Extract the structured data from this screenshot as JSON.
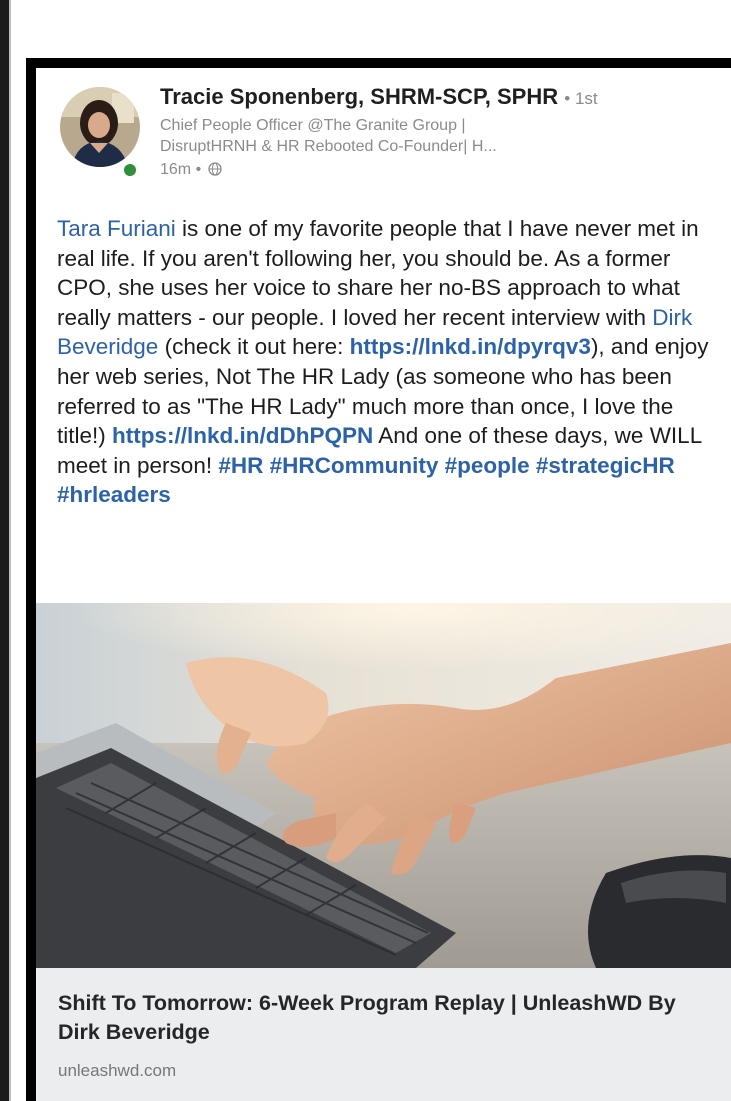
{
  "post": {
    "author": {
      "name": "Tracie Sponenberg, SHRM-SCP, SPHR",
      "degree": "• 1st",
      "headline_line1": "Chief People Officer @The Granite Group |",
      "headline_line2": "DisruptHRNH & HR Rebooted Co-Founder| H...",
      "posted_time": "16m •",
      "avatar_icon": "profile-photo",
      "presence_icon": "online-status-icon",
      "visibility_icon": "globe-icon"
    },
    "body": {
      "mention_tara": "Tara Furiani",
      "text_1": " is one of my favorite people that I have never met in real life.  If you aren't following her, you should be.  As  a former CPO, she uses her voice to share her no-BS approach to what really matters - our people.  I loved her recent interview with ",
      "mention_dirk": "Dirk Beveridge",
      "text_2": " (check it out here: ",
      "link_1": "https://lnkd.in/dpyrqv3",
      "text_3": "), and enjoy her web series, Not The HR Lady (as someone who has been referred to as \"The HR Lady\" much more than once, I love the title!) ",
      "link_2": "https://lnkd.in/dDhPQPN",
      "text_4": " And one of these days, we WILL meet in person!  ",
      "hashtags": "#HR #HRCommunity #people #strategicHR #hrleaders"
    },
    "link_preview": {
      "image_icon": "laptop-typing-photo",
      "title": "Shift To Tomorrow: 6-Week Program Replay | UnleashWD By Dirk Beveridge",
      "domain": "unleashwd.com"
    }
  },
  "colors": {
    "link": "#2b62a8",
    "text": "#1d1d1d",
    "muted": "#8b8b8b",
    "preview_background": "#ebedee",
    "frame": "#000000"
  }
}
